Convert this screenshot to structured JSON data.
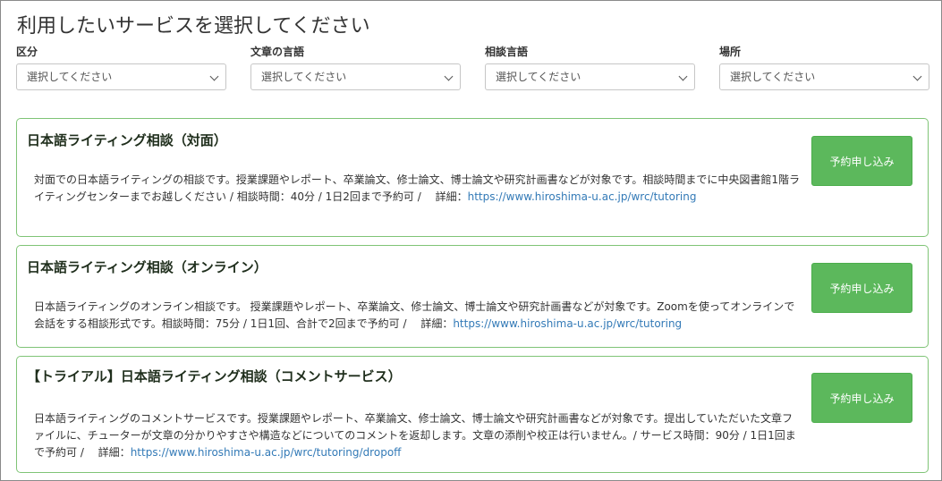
{
  "page": {
    "title": "利用したいサービスを選択してください"
  },
  "filters": [
    {
      "label": "区分",
      "value": "選択してください"
    },
    {
      "label": "文章の言語",
      "value": "選択してください"
    },
    {
      "label": "相談言語",
      "value": "選択してください"
    },
    {
      "label": "場所",
      "value": "選択してください"
    }
  ],
  "services": [
    {
      "title": "日本語ライティング相談（対面）",
      "description": "対面での日本語ライティングの相談です。授業課題やレポート、卒業論文、修士論文、博士論文や研究計画書などが対象です。相談時間までに中央図書館1階ライティングセンターまでお越しください / 相談時間：40分 / 1日2回まで予約可 /　 詳細：",
      "link": "https://www.hiroshima-u.ac.jp/wrc/tutoring",
      "button_label": "予約申し込み"
    },
    {
      "title": "日本語ライティング相談（オンライン）",
      "description": "日本語ライティングのオンライン相談です。 授業課題やレポート、卒業論文、修士論文、博士論文や研究計画書などが対象です。Zoomを使ってオンラインで会話をする相談形式です。相談時間：75分 / 1日1回、合計で2回まで予約可 /　 詳細：",
      "link": "https://www.hiroshima-u.ac.jp/wrc/tutoring",
      "button_label": "予約申し込み"
    },
    {
      "title": "【トライアル】日本語ライティング相談（コメントサービス）",
      "description": "日本語ライティングのコメントサービスです。授業課題やレポート、卒業論文、修士論文、博士論文や研究計画書などが対象です。提出していただいた文章ファイルに、チューターが文章の分かりやすさや構造などについてのコメントを返却します。文章の添削や校正は行いません。/ サービス時間：90分 / 1日1回まで予約可 /　 詳細：",
      "link": "https://www.hiroshima-u.ac.jp/wrc/tutoring/dropoff",
      "button_label": "予約申し込み"
    }
  ],
  "colors": {
    "accent": "#5cb85c",
    "card_border": "#7fc476",
    "link": "#337ab7"
  }
}
